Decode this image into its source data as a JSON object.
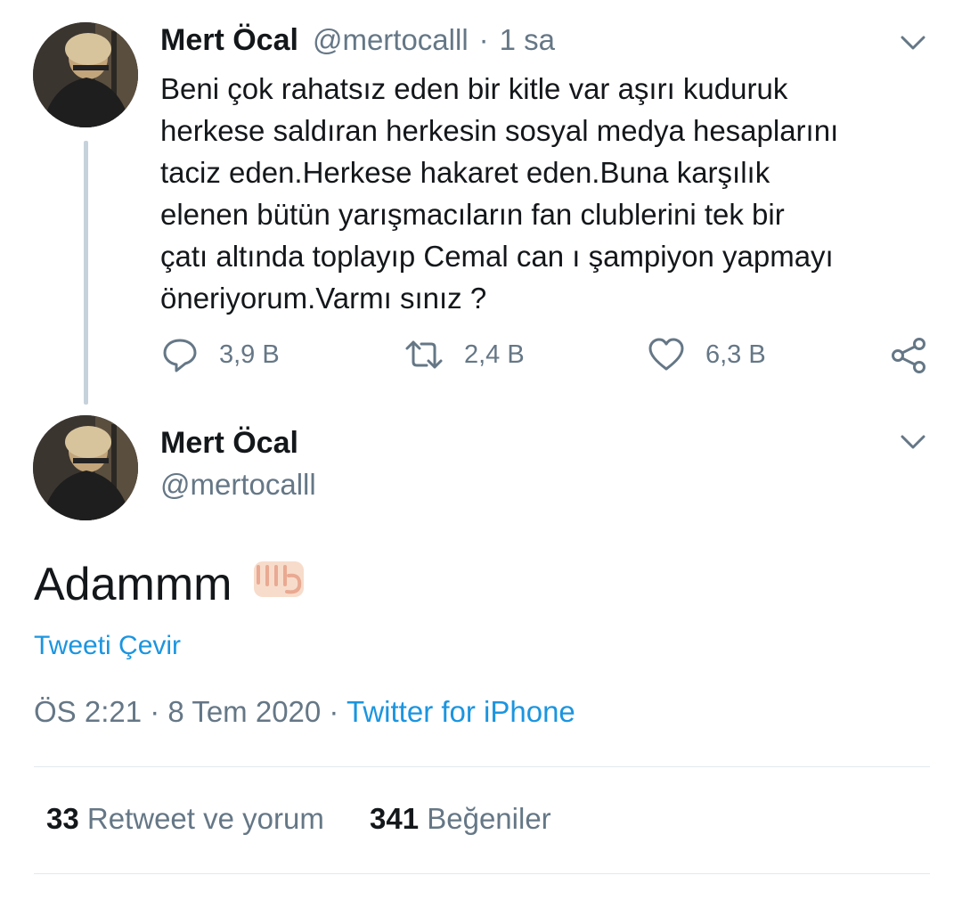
{
  "parent_tweet": {
    "name": "Mert Öcal",
    "handle": "@mertocalll",
    "separator": "·",
    "time": "1 sa",
    "text": "Beni çok rahatsız eden bir kitle var aşırı kuduruk\nherkese saldıran herkesin sosyal medya hesaplarını\ntaciz eden.Herkese hakaret eden.Buna karşılık\nelenen bütün yarışmacıların fan clublerini tek bir\nçatı altında toplayıp Cemal can ı şampiyon yapmayı\nöneriyorum.Varmı sınız ?",
    "actions": {
      "reply_count": "3,9 B",
      "retweet_count": "2,4 B",
      "like_count": "6,3 B"
    }
  },
  "reply_tweet": {
    "name": "Mert Öcal",
    "handle": "@mertocalll",
    "text": "Adammm",
    "emoji": "fist-emoji",
    "translate_label": "Tweeti Çevir",
    "timestamp": "ÖS 2:21 · 8 Tem 2020 ·",
    "source": "Twitter for iPhone",
    "retweet_count": "33",
    "retweet_label": "Retweet ve yorum",
    "like_count": "341",
    "like_label": "Beğeniler"
  },
  "colors": {
    "accent": "#1b95e0",
    "secondary_text": "#657786",
    "thread_line": "#c6d2db"
  }
}
